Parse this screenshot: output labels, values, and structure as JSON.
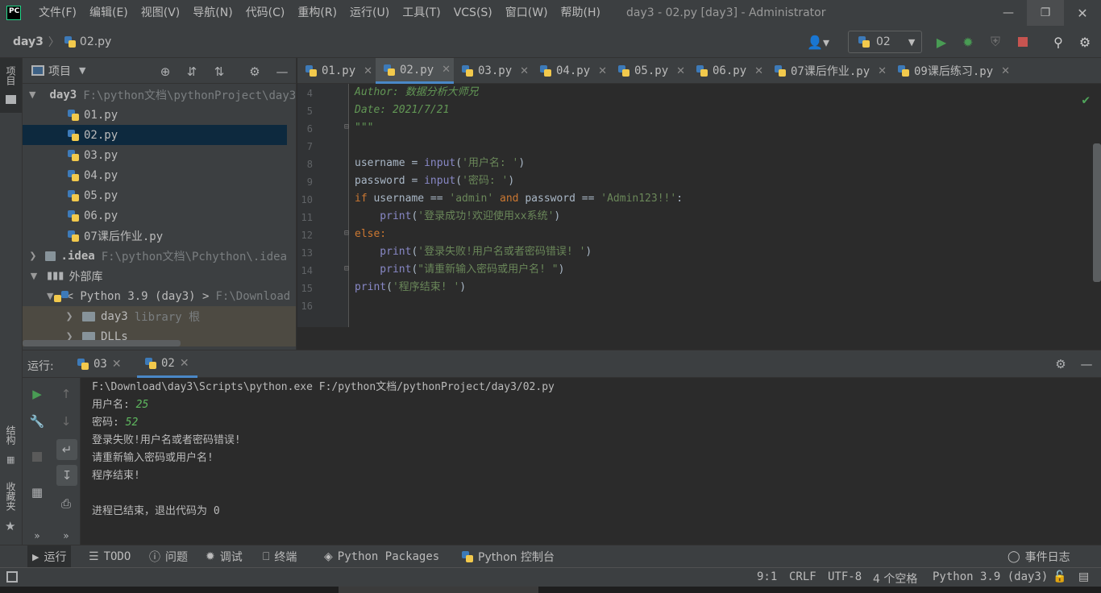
{
  "titlebar": {
    "logo": "PC",
    "menu": [
      "文件(F)",
      "编辑(E)",
      "视图(V)",
      "导航(N)",
      "代码(C)",
      "重构(R)",
      "运行(U)",
      "工具(T)",
      "VCS(S)",
      "窗口(W)",
      "帮助(H)"
    ],
    "window_title": "day3 - 02.py [day3] - Administrator"
  },
  "navbar": {
    "breadcrumb_root": "day3",
    "breadcrumb_file": "02.py",
    "run_config": "02"
  },
  "left_stripe": {
    "project_label": "项目",
    "structure_label": "结构",
    "favorites_label": "收藏夹"
  },
  "project": {
    "title": "项目",
    "tree": [
      {
        "label": "day3",
        "hint": "F:\\python文档\\pythonProject\\day3",
        "kind": "root"
      },
      {
        "label": "01.py",
        "kind": "file"
      },
      {
        "label": "02.py",
        "kind": "file",
        "selected": true
      },
      {
        "label": "03.py",
        "kind": "file"
      },
      {
        "label": "04.py",
        "kind": "file"
      },
      {
        "label": "05.py",
        "kind": "file"
      },
      {
        "label": "06.py",
        "kind": "file"
      },
      {
        "label": "07课后作业.py",
        "kind": "file"
      },
      {
        "label": ".idea",
        "hint": "F:\\python文档\\Pchython\\.idea",
        "kind": "folder"
      },
      {
        "label": "外部库",
        "kind": "library"
      },
      {
        "label": "< Python 3.9 (day3) >",
        "hint": "F:\\Download",
        "kind": "sdk"
      },
      {
        "label": "day3",
        "hint": "library 根",
        "kind": "libfolder"
      },
      {
        "label": "DLLs",
        "kind": "libfolder"
      }
    ]
  },
  "editor": {
    "tabs": [
      "01.py",
      "02.py",
      "03.py",
      "04.py",
      "05.py",
      "06.py",
      "07课后作业.py",
      "09课后练习.py"
    ],
    "active_tab": "02.py",
    "line_numbers": [
      "4",
      "5",
      "6",
      "7",
      "8",
      "9",
      "10",
      "11",
      "12",
      "13",
      "14",
      "15",
      "16"
    ],
    "code": {
      "l4": "Author: 数据分析大师兄",
      "l5": "Date: 2021/7/21",
      "l6": "\"\"\"",
      "l8_a": "username = ",
      "l8_b": "input",
      "l8_c": "(",
      "l8_d": "'用户名: '",
      "l8_e": ")",
      "l9_a": "password = ",
      "l9_b": "input",
      "l9_c": "(",
      "l9_d": "'密码: '",
      "l9_e": ")",
      "l10_a": "if",
      "l10_b": " username == ",
      "l10_c": "'admin'",
      "l10_d": " and",
      "l10_e": " password == ",
      "l10_f": "'Admin123!!'",
      "l10_g": ":",
      "l11_a": "    print",
      "l11_b": "(",
      "l11_c": "'登录成功!欢迎使用xx系统'",
      "l11_d": ")",
      "l12": "else:",
      "l13_a": "    print",
      "l13_b": "(",
      "l13_c": "'登录失败!用户名或者密码错误! '",
      "l13_d": ")",
      "l14_a": "    print",
      "l14_b": "(",
      "l14_c": "\"请重新输入密码或用户名! \"",
      "l14_d": ")",
      "l15_a": "print",
      "l15_b": "(",
      "l15_c": "'程序结束! '",
      "l15_d": ")"
    }
  },
  "run": {
    "label": "运行:",
    "tabs": [
      "03",
      "02"
    ],
    "active_tab": "02",
    "console": {
      "cmd": "F:\\Download\\day3\\Scripts\\python.exe F:/python文档/pythonProject/day3/02.py",
      "prompt_user": "用户名: ",
      "input_user": "25",
      "prompt_pass": "密码: ",
      "input_pass": "52",
      "out1": "登录失败!用户名或者密码错误!",
      "out2": "请重新输入密码或用户名!",
      "out3": "程序结束!",
      "exit": "进程已结束，退出代码为 0"
    }
  },
  "bottom_bar": {
    "run": "运行",
    "todo": "TODO",
    "problems": "问题",
    "debug": "调试",
    "terminal": "终端",
    "packages": "Python Packages",
    "console": "Python 控制台",
    "event_log": "事件日志"
  },
  "status_bar": {
    "position": "9:1",
    "line_sep": "CRLF",
    "encoding": "UTF-8",
    "indent": "4 个空格",
    "interpreter": "Python 3.9 (day3)"
  },
  "colors": {
    "accent": "#4a88c7",
    "run_green": "#499c54",
    "stop_red": "#c75450",
    "console_input": "#5fb95f"
  }
}
